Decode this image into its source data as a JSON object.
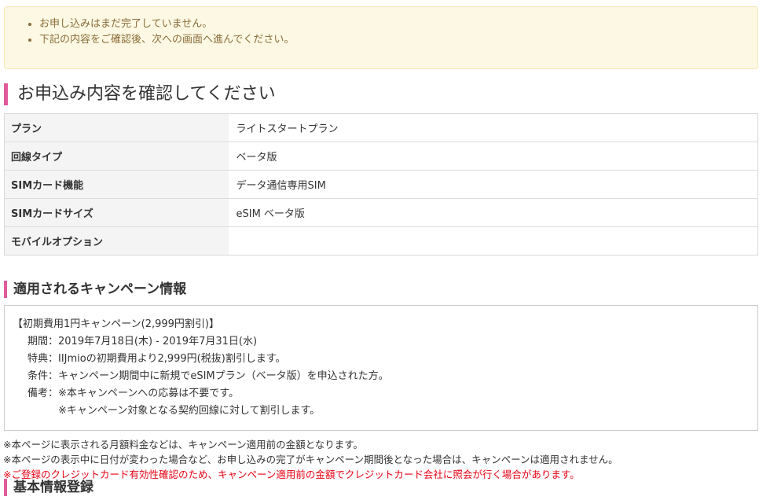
{
  "notice": {
    "items": [
      "お申し込みはまだ完了していません。",
      "下記の内容をご確認後、次への画面へ進んでください。"
    ]
  },
  "confirm": {
    "heading": "お申込み内容を確認してください",
    "rows": [
      {
        "label": "プラン",
        "value": "ライトスタートプラン"
      },
      {
        "label": "回線タイプ",
        "value": "ベータ版"
      },
      {
        "label": "SIMカード機能",
        "value": "データ通信専用SIM"
      },
      {
        "label": "SIMカードサイズ",
        "value": "eSIM ベータ版"
      },
      {
        "label": "モバイルオプション",
        "value": ""
      }
    ]
  },
  "campaign": {
    "heading": "適用されるキャンペーン情報",
    "title": "【初期費用1円キャンペーン(2,999円割引)】",
    "period_key": "期間：",
    "period_value": "2019年7月18日(木) - 2019年7月31日(水)",
    "benefit_key": "特典：",
    "benefit_value": "IIJmioの初期費用より2,999円(税抜)割引します。",
    "condition_key": "条件：",
    "condition_value": "キャンペーン期間中に新規でeSIMプラン（ベータ版）を申込された方。",
    "remarks_key": "備考：",
    "remarks_1": "※本キャンペーンへの応募は不要です。",
    "remarks_2": "※キャンペーン対象となる契約回線に対して割引します。"
  },
  "notes": {
    "note1": "※本ページに表示される月額料金などは、キャンペーン適用前の金額となります。",
    "note2": "※本ページの表示中に日付が変わった場合など、お申し込みの完了がキャンペーン期間後となった場合は、キャンペーンは適用されません。",
    "note3": "※ご登録のクレジットカード有効性確認のため、キャンペーン適用前の金額でクレジットカード会社に照会が行く場合があります。"
  },
  "basic_info": {
    "heading": "基本情報登録"
  },
  "colors": {
    "accent": "#e25b9b",
    "notice_bg": "#fcf8e3",
    "notice_text": "#8a6d3b",
    "warning_red": "#e60012"
  }
}
